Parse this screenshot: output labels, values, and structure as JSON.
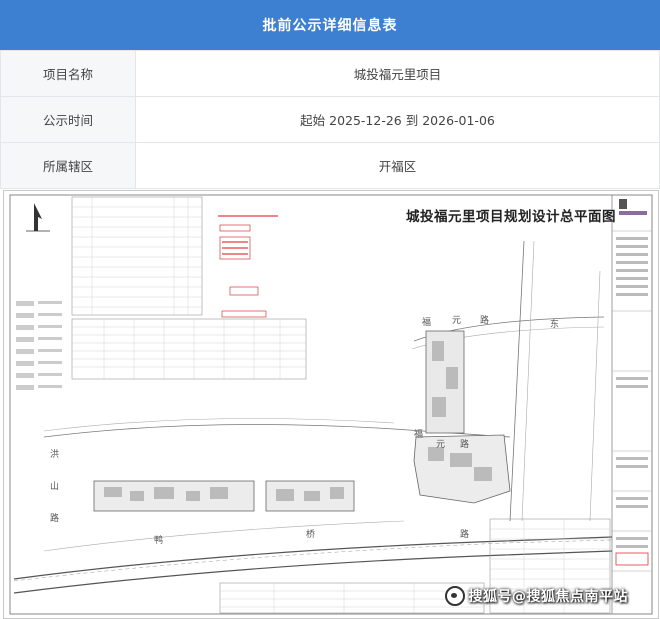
{
  "header": {
    "title": "批前公示详细信息表"
  },
  "info_rows": [
    {
      "label": "项目名称",
      "value": "城投福元里项目"
    },
    {
      "label": "公示时间",
      "value": "起始 2025-12-26 到 2026-01-06"
    },
    {
      "label": "所属辖区",
      "value": "开福区"
    }
  ],
  "plan": {
    "title": "城投福元里项目规划设计总平面图",
    "road_labels": [
      "福",
      "元",
      "路",
      "东",
      "洪",
      "山",
      "路",
      "福",
      "元",
      "路",
      "鸭",
      "桥",
      "路"
    ],
    "watermark": "搜狐号@搜狐焦点南平站"
  },
  "colors": {
    "header_bg": "#3d7fd1",
    "label_bg": "#f6f7f9",
    "border": "#e3e6eb",
    "red_note": "#d9383a"
  }
}
